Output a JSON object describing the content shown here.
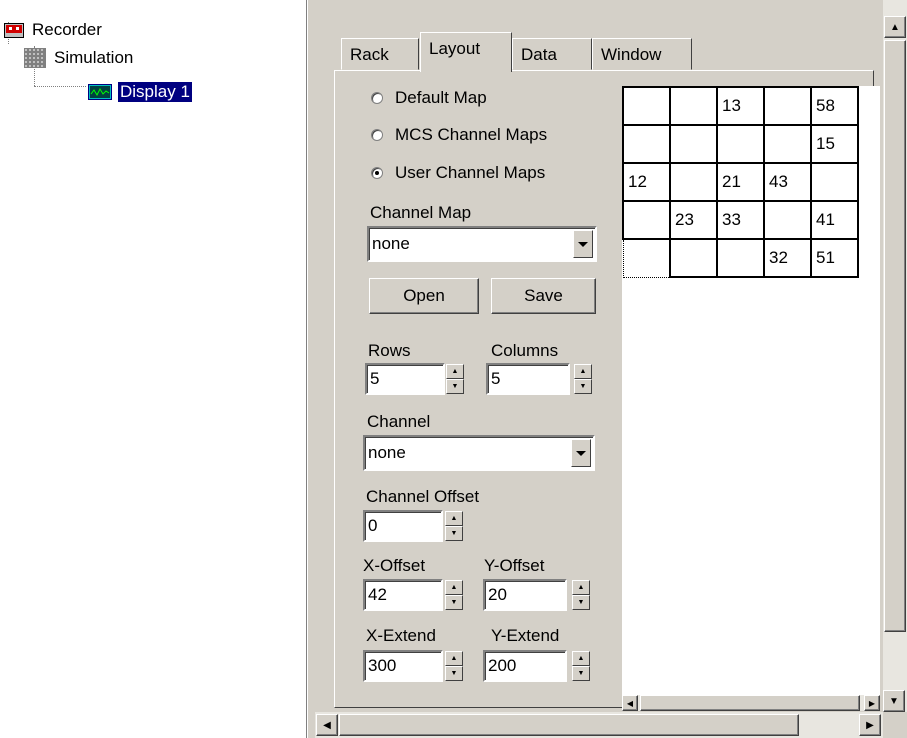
{
  "tree": {
    "items": [
      {
        "label": "Recorder",
        "icon": "recorder-icon"
      },
      {
        "label": "Simulation",
        "icon": "simulation-grid-icon"
      },
      {
        "label": "Display 1",
        "icon": "display-icon",
        "selected": true
      }
    ]
  },
  "tabs": [
    {
      "label": "Rack",
      "active": false
    },
    {
      "label": "Layout",
      "active": true
    },
    {
      "label": "Data",
      "active": false
    },
    {
      "label": "Window",
      "active": false
    }
  ],
  "layout": {
    "map_options": [
      {
        "label": "Default Map",
        "checked": false
      },
      {
        "label": "MCS Channel Maps",
        "checked": false
      },
      {
        "label": "User Channel Maps",
        "checked": true
      }
    ],
    "channel_map_label": "Channel Map",
    "channel_map_value": "none",
    "open_label": "Open",
    "save_label": "Save",
    "rows_label": "Rows",
    "rows_value": "5",
    "columns_label": "Columns",
    "columns_value": "5",
    "channel_label": "Channel",
    "channel_value": "none",
    "channel_offset_label": "Channel Offset",
    "channel_offset_value": "0",
    "x_offset_label": "X-Offset",
    "x_offset_value": "42",
    "y_offset_label": "Y-Offset",
    "y_offset_value": "20",
    "x_extend_label": "X-Extend",
    "x_extend_value": "300",
    "y_extend_label": "Y-Extend",
    "y_extend_value": "200"
  },
  "grid": {
    "rows": [
      [
        "",
        "",
        "13",
        "",
        "58"
      ],
      [
        "",
        "",
        "",
        "",
        "15"
      ],
      [
        "12",
        "",
        "21",
        "43",
        ""
      ],
      [
        "",
        "23",
        "33",
        "",
        "41"
      ],
      [
        "",
        "",
        "",
        "32",
        "51"
      ]
    ]
  }
}
